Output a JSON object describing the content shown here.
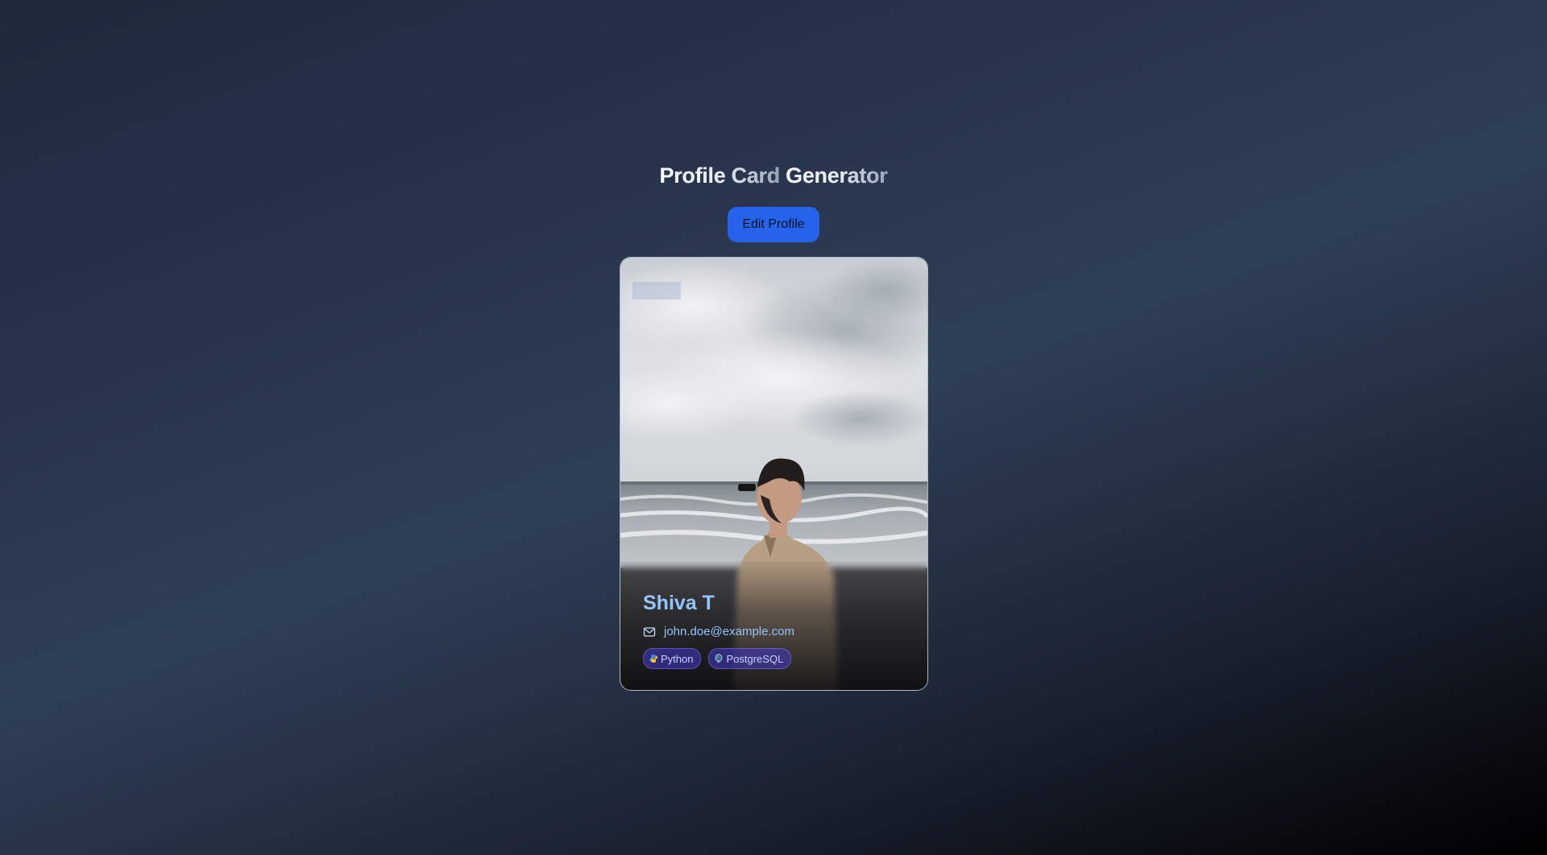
{
  "header": {
    "title_part1": "Profile Card",
    "title_part2": "Generator"
  },
  "toolbar": {
    "edit_label": "Edit Profile"
  },
  "profile": {
    "name": "Shiva T",
    "email": "john.doe@example.com",
    "email_icon": "mail-icon",
    "skills": [
      {
        "label": "Python",
        "icon": "python-icon"
      },
      {
        "label": "PostgreSQL",
        "icon": "postgresql-icon"
      }
    ]
  },
  "colors": {
    "accent": "#2563eb",
    "name_color": "#93c5fd",
    "tag_bg": "#4338ca"
  }
}
